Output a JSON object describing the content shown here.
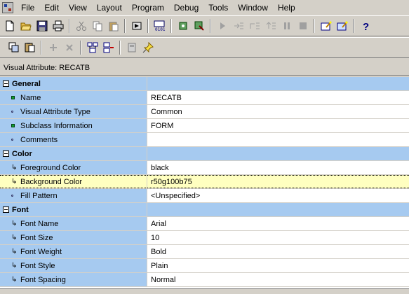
{
  "menu": [
    "File",
    "Edit",
    "View",
    "Layout",
    "Program",
    "Debug",
    "Tools",
    "Window",
    "Help"
  ],
  "title_strip": "Visual Attribute: RECATB",
  "palette": {
    "categories": [
      {
        "label": "General",
        "rows": [
          {
            "name": "Name",
            "value": "RECATB",
            "marker": "green"
          },
          {
            "name": "Visual Attribute Type",
            "value": "Common",
            "marker": "dot"
          },
          {
            "name": "Subclass Information",
            "value": "FORM",
            "marker": "green"
          },
          {
            "name": "Comments",
            "value": "",
            "marker": "dot"
          }
        ]
      },
      {
        "label": "Color",
        "rows": [
          {
            "name": "Foreground Color",
            "value": "black",
            "marker": "inherit"
          },
          {
            "name": "Background Color",
            "value": "r50g100b75",
            "marker": "inherit",
            "selected": true
          },
          {
            "name": "Fill Pattern",
            "value": "<Unspecified>",
            "marker": "dot"
          }
        ]
      },
      {
        "label": "Font",
        "rows": [
          {
            "name": "Font Name",
            "value": "Arial",
            "marker": "inherit"
          },
          {
            "name": "Font Size",
            "value": "10",
            "marker": "inherit"
          },
          {
            "name": "Font Weight",
            "value": "Bold",
            "marker": "inherit"
          },
          {
            "name": "Font Style",
            "value": "Plain",
            "marker": "inherit"
          },
          {
            "name": "Font Spacing",
            "value": "Normal",
            "marker": "inherit"
          }
        ]
      }
    ]
  },
  "icons": {
    "toolbar1": [
      "new-icon",
      "open-icon",
      "save-icon",
      "print-icon",
      "cut-icon",
      "copy-icon",
      "paste-icon",
      "run-form-icon",
      "compile-icon",
      "debug-icon",
      "debug-step-icon",
      "go-icon",
      "step-into-icon",
      "step-over-icon",
      "step-out-icon",
      "pause-icon",
      "stop-icon",
      "wizard-icon",
      "wizard2-icon",
      "help-icon"
    ],
    "toolbar2": [
      "copy-properties-icon",
      "paste-properties-icon",
      "add-property-icon",
      "delete-property-icon",
      "union-icon",
      "intersection-icon",
      "freeze-icon",
      "pin-icon"
    ]
  }
}
